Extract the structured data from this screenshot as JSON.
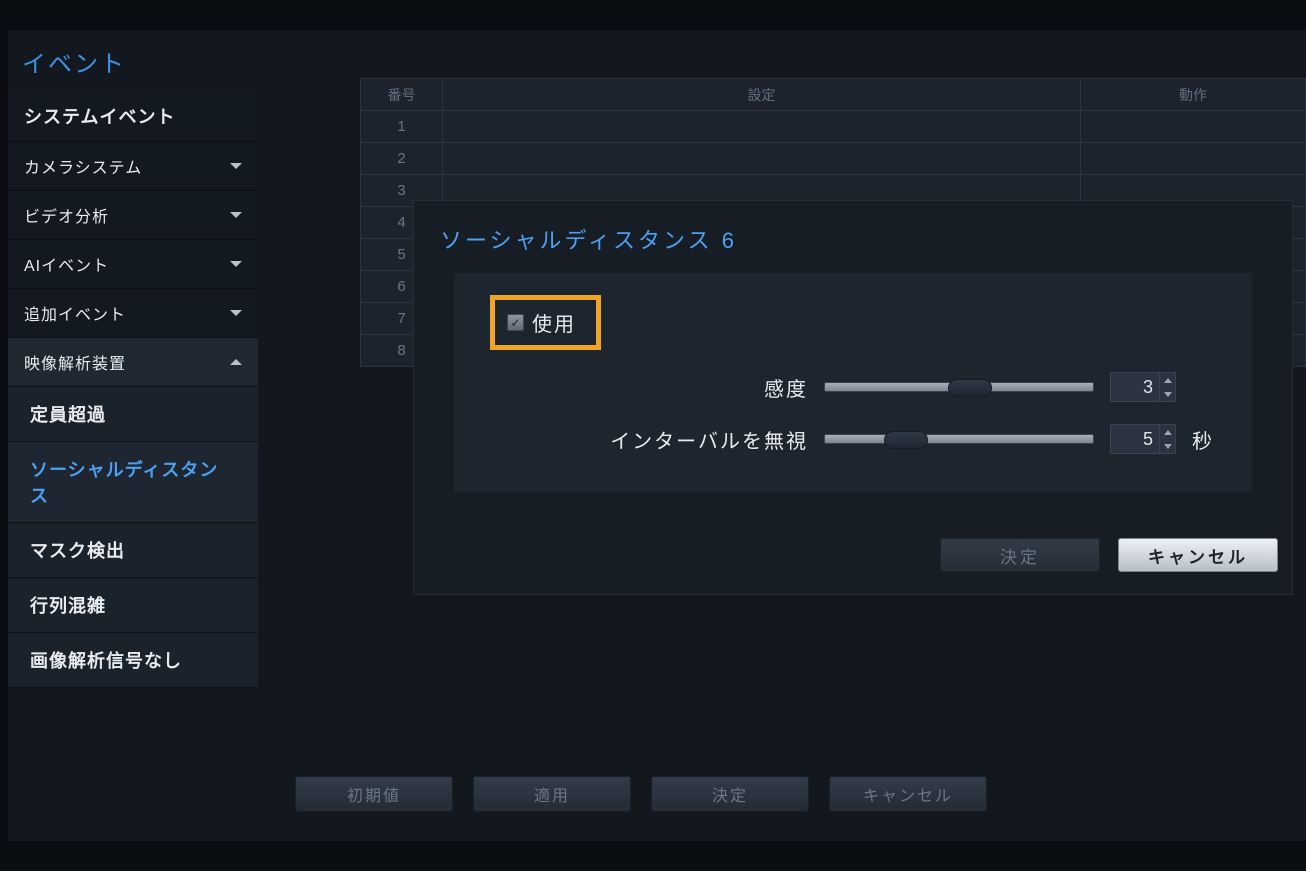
{
  "sidebar": {
    "title": "イベント",
    "items": [
      {
        "label": "システムイベント",
        "type": "item"
      },
      {
        "label": "カメラシステム",
        "type": "dropdown"
      },
      {
        "label": "ビデオ分析",
        "type": "dropdown"
      },
      {
        "label": "AIイベント",
        "type": "dropdown"
      },
      {
        "label": "追加イベント",
        "type": "dropdown"
      },
      {
        "label": "映像解析装置",
        "type": "dropdown-expanded"
      }
    ],
    "subitems": [
      {
        "label": "定員超過"
      },
      {
        "label": "ソーシャルディスタンス",
        "active": true
      },
      {
        "label": "マスク検出"
      },
      {
        "label": "行列混雑"
      },
      {
        "label": "画像解析信号なし"
      }
    ]
  },
  "table": {
    "headers": {
      "num": "番号",
      "set": "設定",
      "op": "動作"
    },
    "rows": [
      1,
      2,
      3,
      4,
      5,
      6,
      7,
      8
    ]
  },
  "dialog": {
    "title": "ソーシャルディスタンス 6",
    "use_label": "使用",
    "params": {
      "sensitivity": {
        "label": "感度",
        "value": "3",
        "thumb_pct": 46
      },
      "ignore_interval": {
        "label": "インターバルを無視",
        "value": "5",
        "unit": "秒",
        "thumb_pct": 22
      }
    },
    "buttons": {
      "ok": "決定",
      "cancel": "キャンセル"
    }
  },
  "bottom": {
    "reset": "初期値",
    "apply": "適用",
    "ok": "決定",
    "cancel": "キャンセル"
  }
}
